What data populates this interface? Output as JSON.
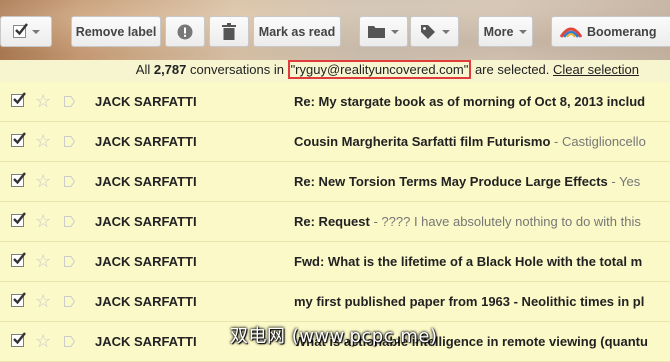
{
  "toolbar": {
    "remove_label": "Remove label",
    "mark_read": "Mark as read",
    "more": "More",
    "boomerang": "Boomerang"
  },
  "banner": {
    "prefix": "All ",
    "count": "2,787",
    "middle": " conversations in ",
    "label": "\"ryguy@realityuncovered.com\"",
    "suffix": " are selected. ",
    "clear": "Clear selection"
  },
  "rows": [
    {
      "sender": "JACK SARFATTI",
      "subject": "Re: My stargate book as of morning of Oct 8, 2013 includ",
      "snippet": ""
    },
    {
      "sender": "JACK SARFATTI",
      "subject": "Cousin Margherita Sarfatti film Futurismo",
      "snippet": " - Castiglioncello"
    },
    {
      "sender": "JACK SARFATTI",
      "subject": "Re: New Torsion Terms May Produce Large Effects",
      "snippet": " - Yes"
    },
    {
      "sender": "JACK SARFATTI",
      "subject": "Re: Request",
      "snippet": " - ???? I have absolutely nothing to do with this"
    },
    {
      "sender": "JACK SARFATTI",
      "subject": "Fwd: What is the lifetime of a Black Hole with the total m",
      "snippet": ""
    },
    {
      "sender": "JACK SARFATTI",
      "subject": "my first published paper from 1963 - Neolithic times in pl",
      "snippet": ""
    },
    {
      "sender": "JACK SARFATTI",
      "subject": "What is actionable intelligence in remote viewing (quantu",
      "snippet": ""
    }
  ],
  "watermark": "双电网 (www.pcpc.me)",
  "colors": {
    "row_bg": "#fbf9c8",
    "highlight": "#e03c3c"
  }
}
